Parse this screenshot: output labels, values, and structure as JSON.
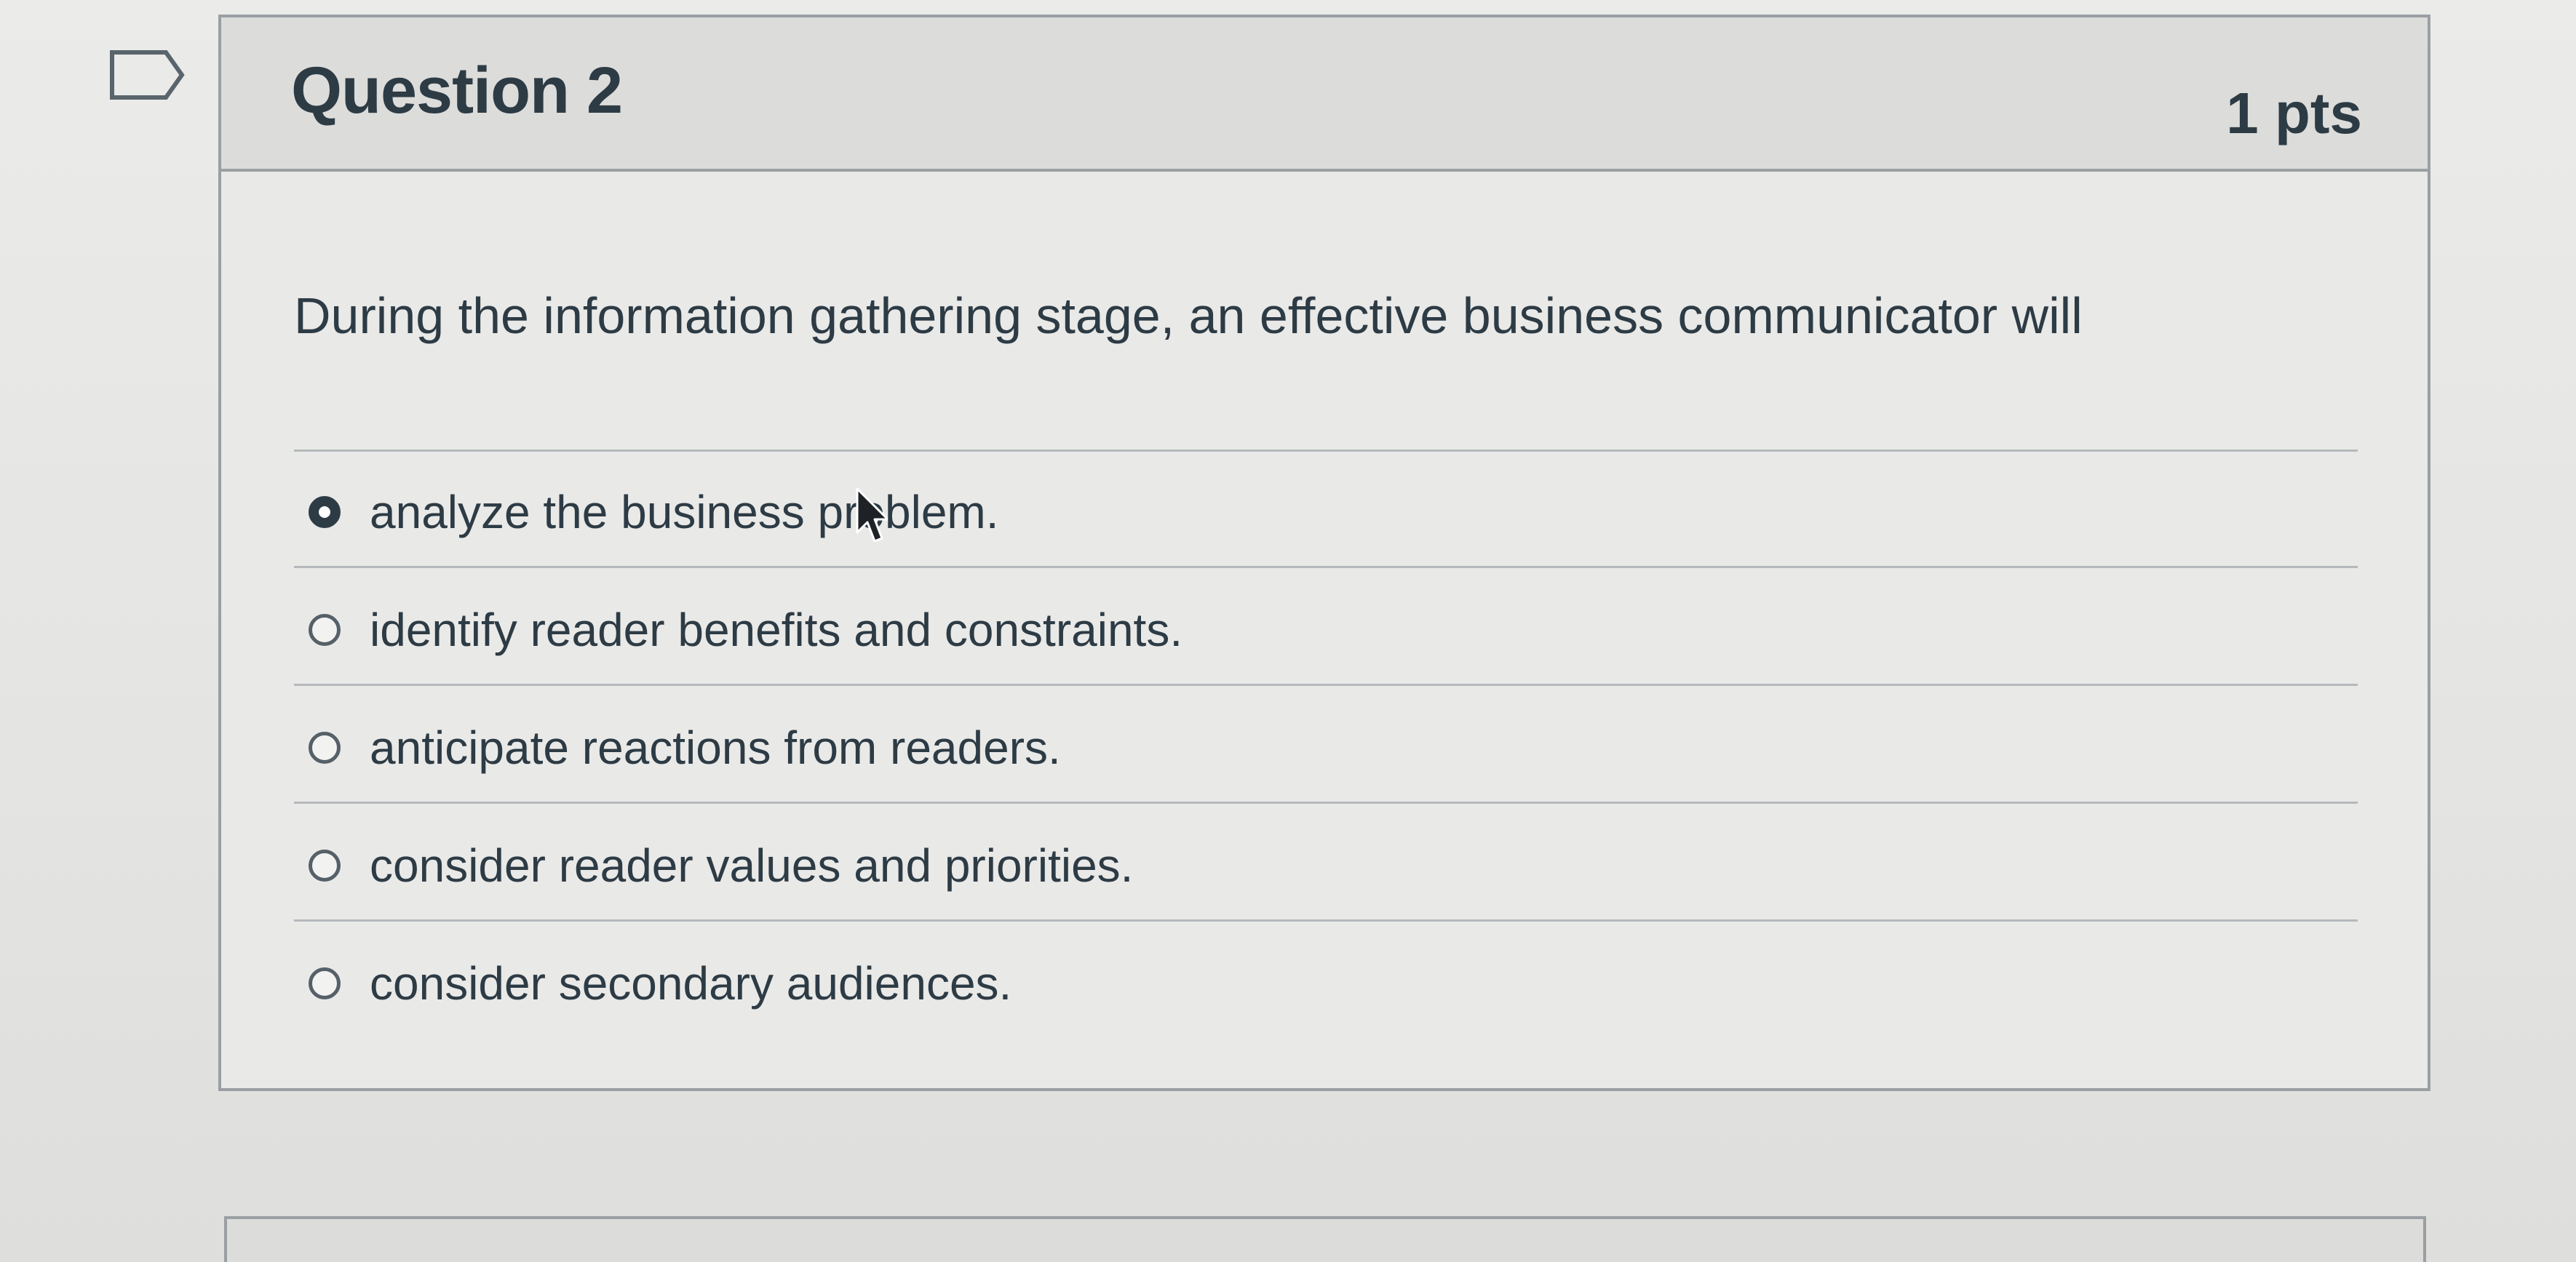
{
  "question": {
    "title": "Question 2",
    "points": "1 pts",
    "text": "During the information gathering stage, an effective business communicator will",
    "flag_icon": "flag-outline-icon",
    "answers": [
      {
        "label": "analyze the business problem.",
        "selected": true
      },
      {
        "label": "identify reader benefits and constraints.",
        "selected": false
      },
      {
        "label": "anticipate reactions from readers.",
        "selected": false
      },
      {
        "label": "consider reader values and priorities.",
        "selected": false
      },
      {
        "label": "consider secondary audiences.",
        "selected": false
      }
    ]
  },
  "colors": {
    "text": "#2d3b45",
    "border": "#9a9fa3",
    "header_bg": "#dcdcda"
  }
}
